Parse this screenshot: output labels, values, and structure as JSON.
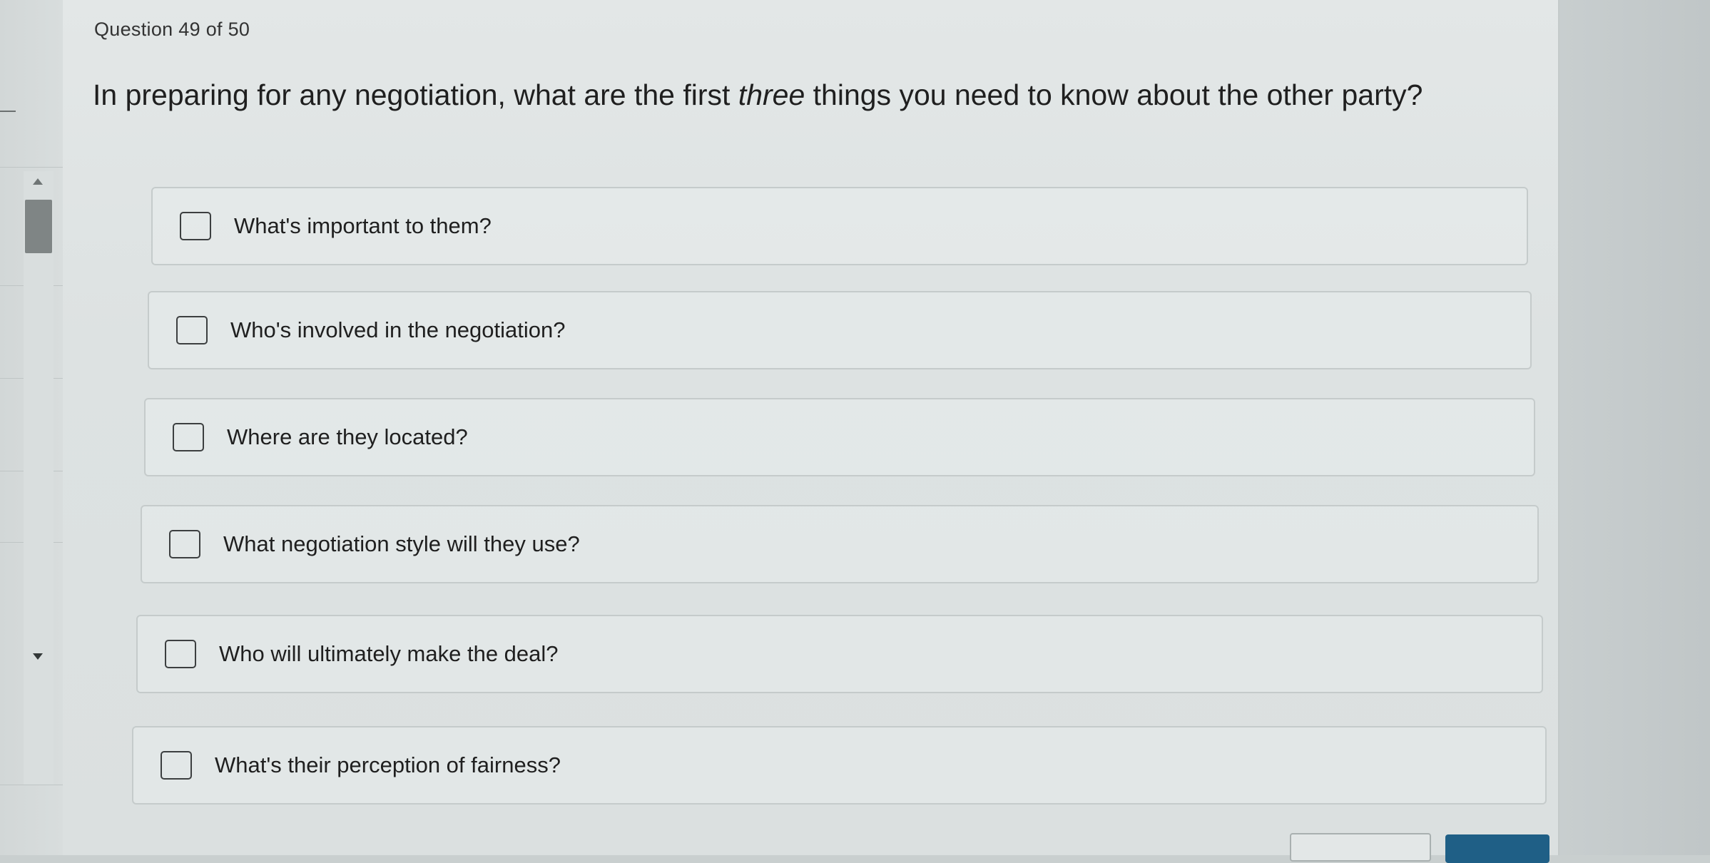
{
  "question": {
    "counter": "Question 49 of 50",
    "text_before": "In preparing for any negotiation, what are the first ",
    "text_emphasis": "three",
    "text_after": " things you need to know about the other party?"
  },
  "options": [
    {
      "label": "What's important to them?",
      "checked": false
    },
    {
      "label": "Who's involved in the negotiation?",
      "checked": false
    },
    {
      "label": "Where are they located?",
      "checked": false
    },
    {
      "label": "What negotiation style will they use?",
      "checked": false
    },
    {
      "label": "Who will ultimately make the deal?",
      "checked": false
    },
    {
      "label": "What's their perception of fairness?",
      "checked": false
    }
  ],
  "colors": {
    "next_button": "#1f5f86",
    "text": "#1f1f1f"
  },
  "icons": {
    "scroll_up": "triangle-up",
    "scroll_down": "triangle-down"
  }
}
